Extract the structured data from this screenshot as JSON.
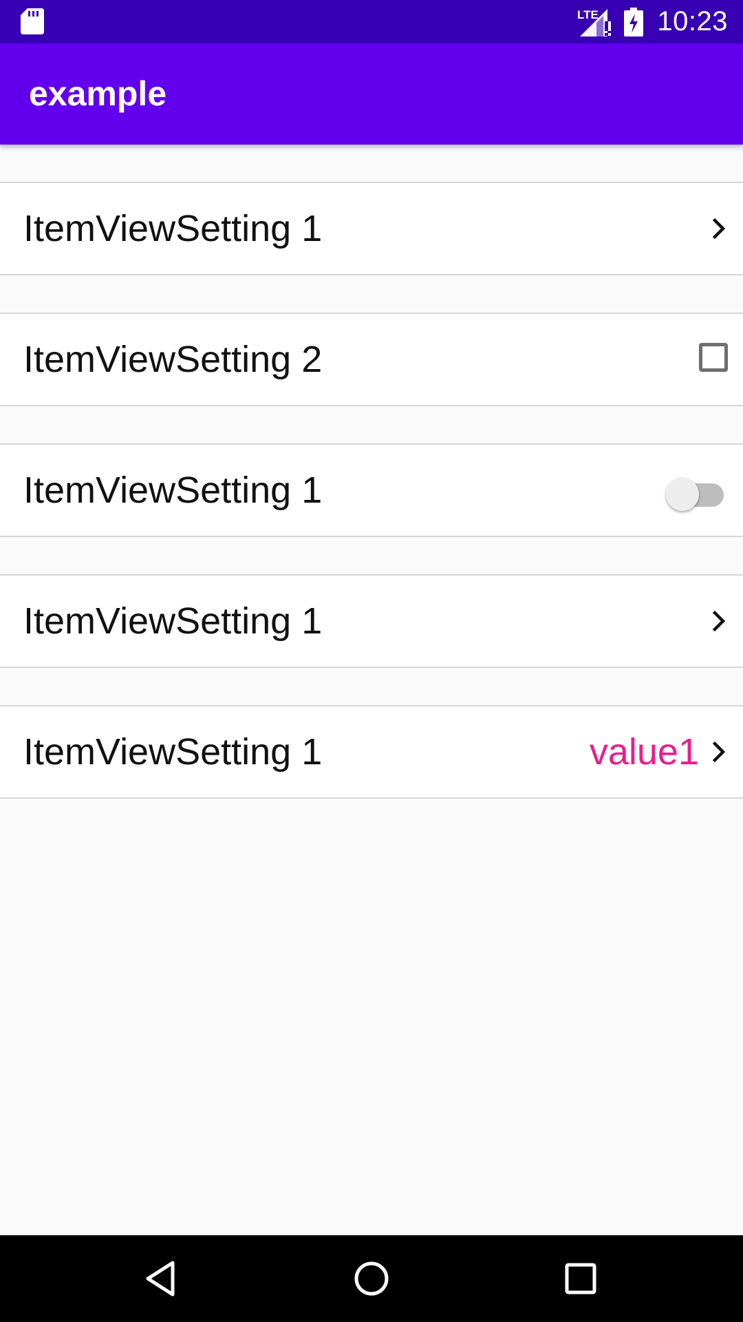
{
  "status_bar": {
    "time": "10:23",
    "network_label": "LTE",
    "icons": [
      "sd-card-icon",
      "signal-icon",
      "battery-charging-icon"
    ]
  },
  "app_bar": {
    "title": "example"
  },
  "settings": [
    {
      "label": "ItemViewSetting 1",
      "control": "chevron"
    },
    {
      "label": "ItemViewSetting 2",
      "control": "checkbox",
      "checked": false
    },
    {
      "label": "ItemViewSetting 1",
      "control": "switch",
      "on": false
    },
    {
      "label": "ItemViewSetting 1",
      "control": "chevron"
    },
    {
      "label": "ItemViewSetting 1",
      "control": "value-chevron",
      "value": "value1"
    }
  ],
  "colors": {
    "status_bar": "#3700B3",
    "app_bar": "#6200EE",
    "value_text": "#E91E8C",
    "background": "#FAFAFA"
  },
  "nav_bar": {
    "buttons": [
      "back-icon",
      "home-icon",
      "recents-icon"
    ]
  }
}
